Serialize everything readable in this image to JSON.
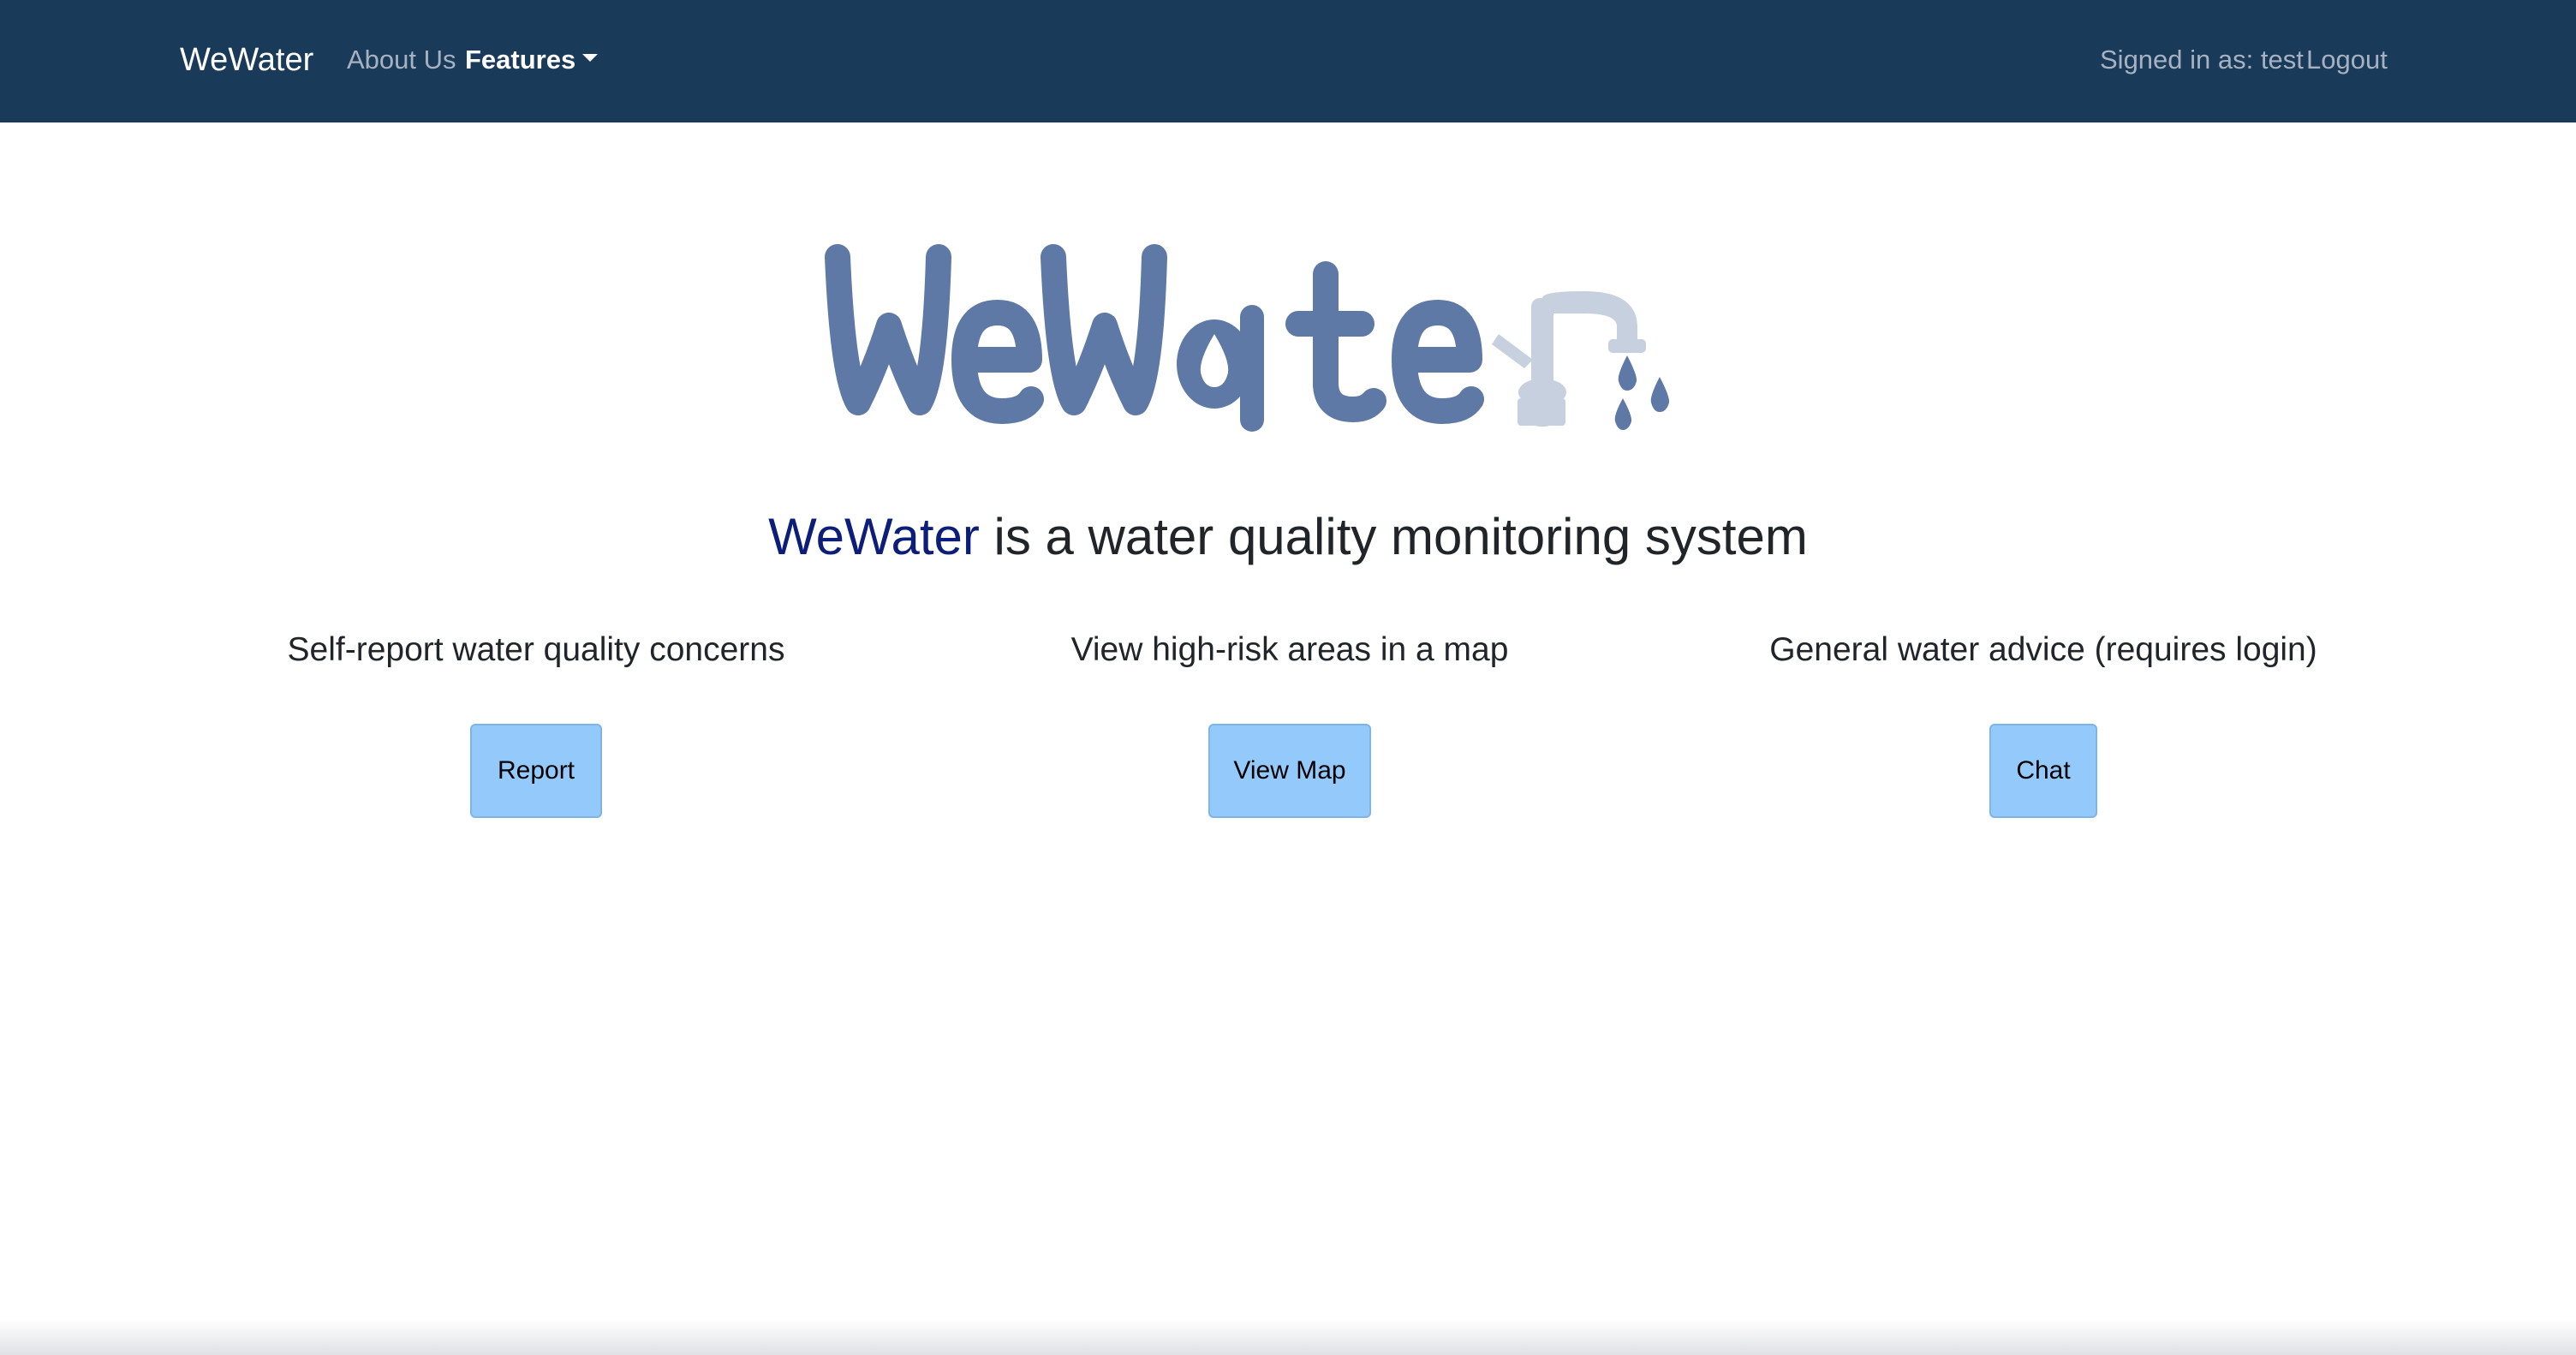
{
  "navbar": {
    "brand": "WeWater",
    "links": [
      {
        "label": "About Us"
      },
      {
        "label": "Features"
      }
    ],
    "signed_in": "Signed in as: test",
    "logout": "Logout"
  },
  "logo": {
    "text": "WeWater",
    "icon": "faucet-icon",
    "colors": {
      "letters": "#5f79a6",
      "faucet": "#c7d0de"
    }
  },
  "hero": {
    "brand": "WeWater",
    "tagline_rest": " is a water quality monitoring system"
  },
  "features": [
    {
      "title": "Self-report water quality concerns",
      "button": "Report"
    },
    {
      "title": "View high-risk areas in a map",
      "button": "View Map"
    },
    {
      "title": "General water advice (requires login)",
      "button": "Chat"
    }
  ],
  "colors": {
    "navbar_bg": "#193a58",
    "button_bg": "#94c9fb",
    "brand_text": "#0d1d7a"
  }
}
